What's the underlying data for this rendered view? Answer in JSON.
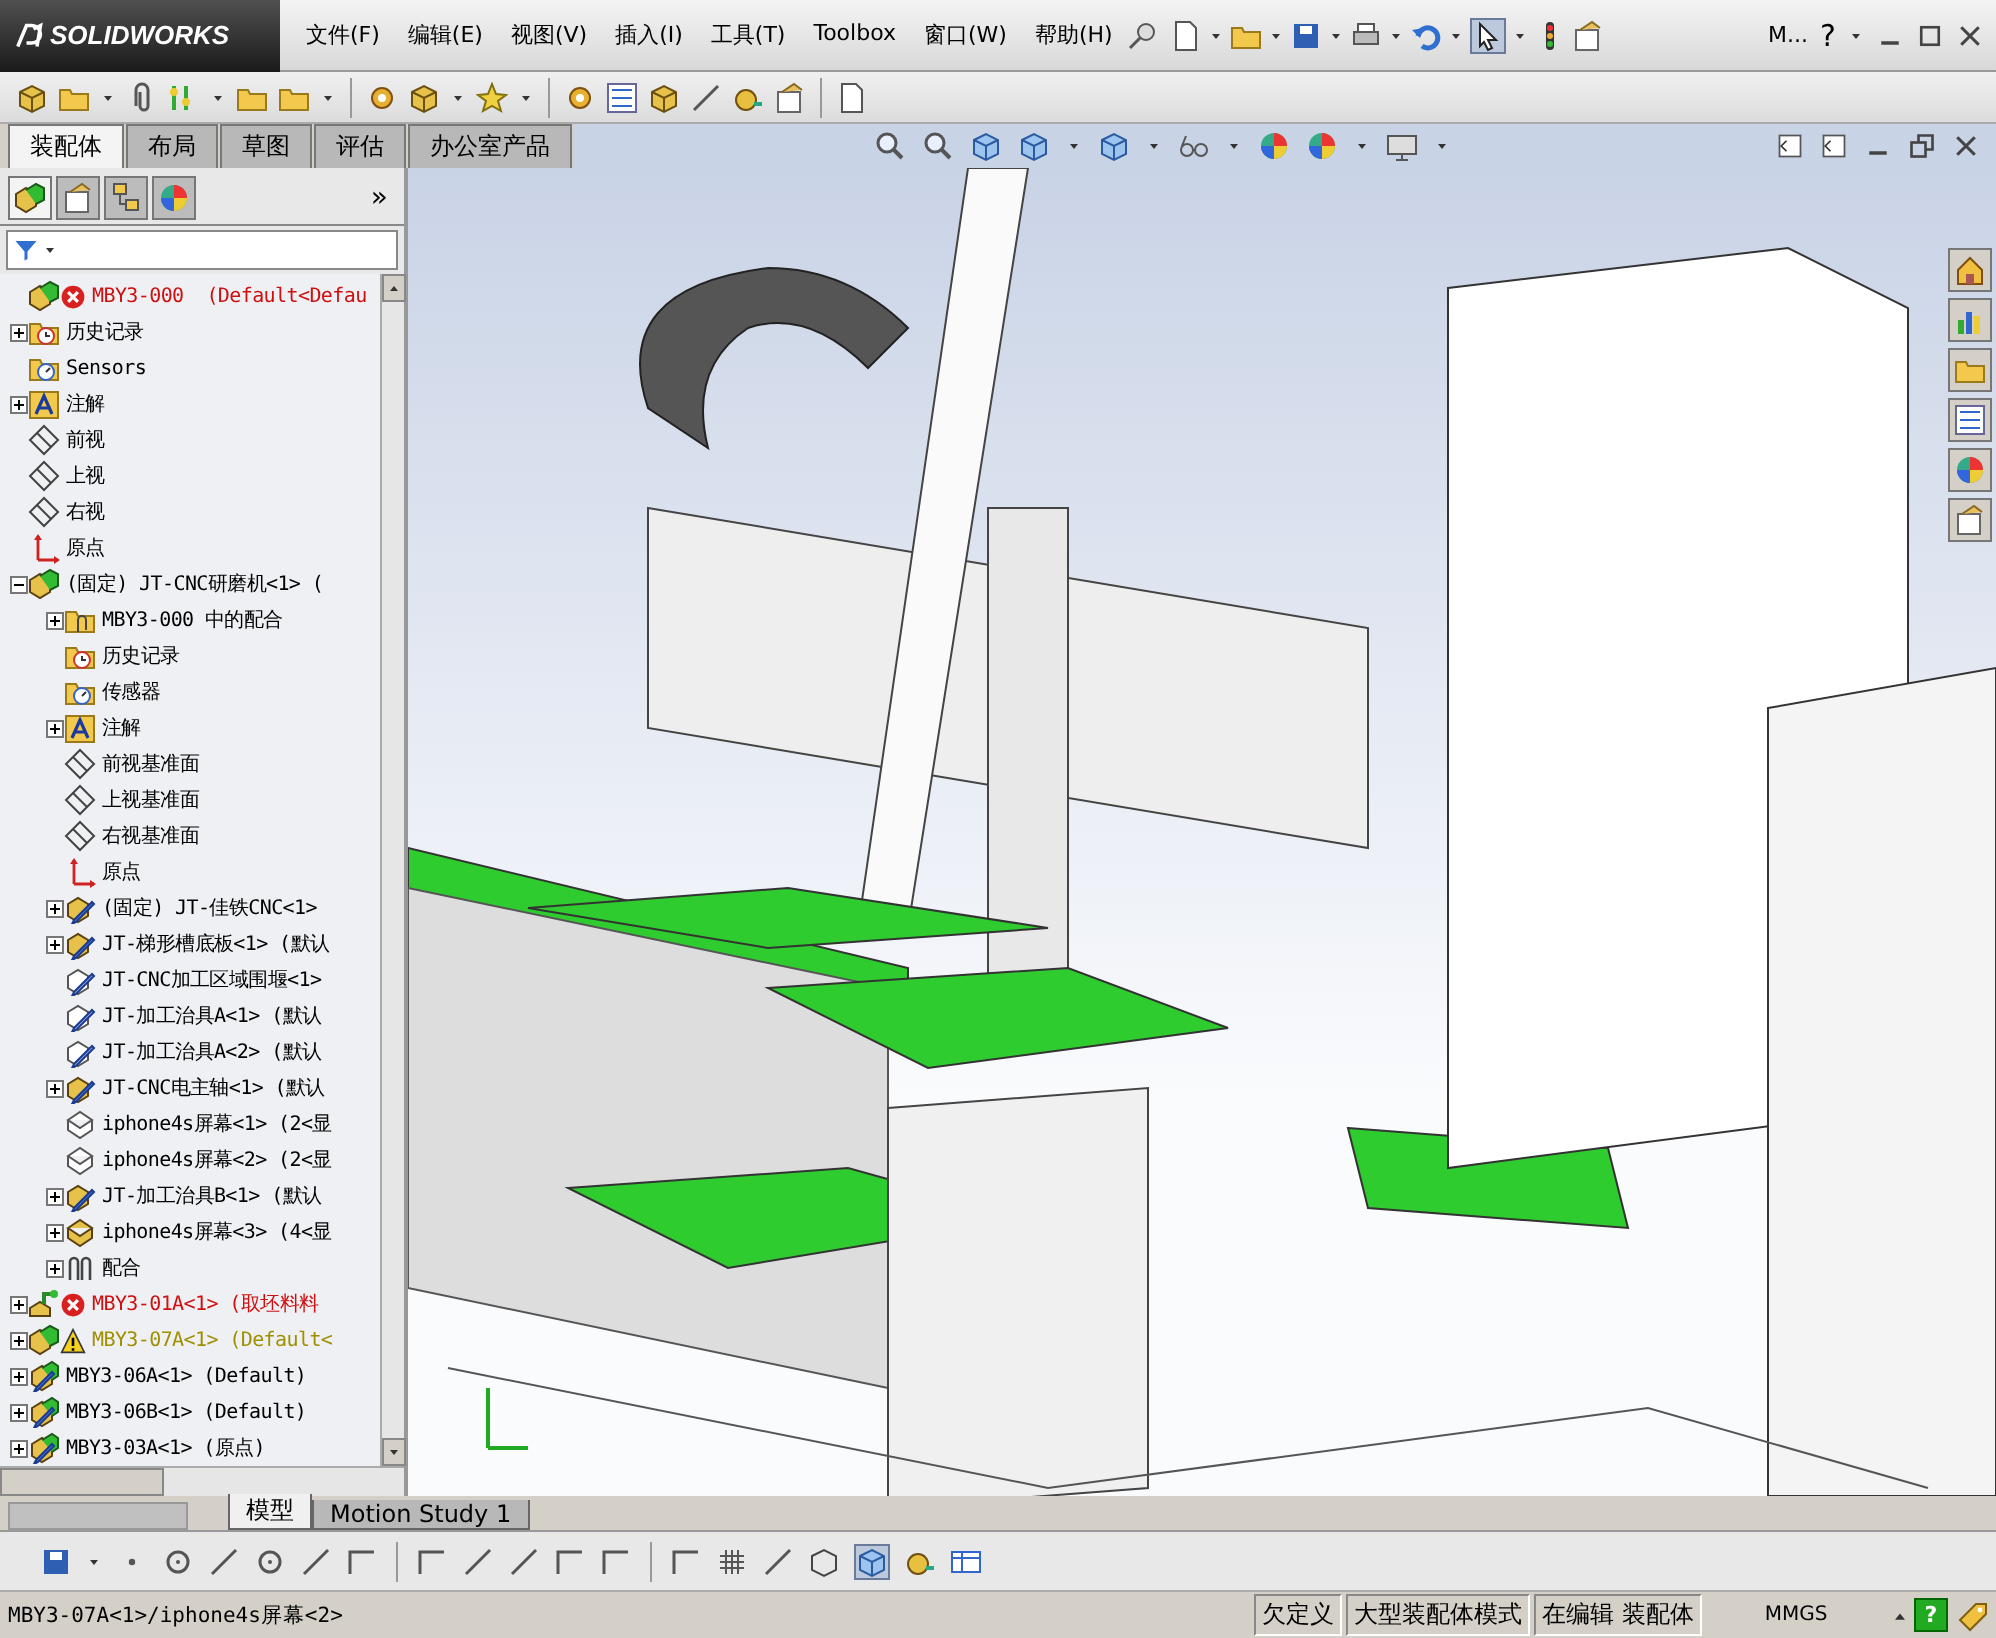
{
  "window": {
    "logo": "SOLIDWORKS",
    "menu": [
      "文件(F)",
      "编辑(E)",
      "视图(V)",
      "插入(I)",
      "工具(T)",
      "Toolbox",
      "窗口(W)",
      "帮助(H)"
    ],
    "truncated_label": "M...",
    "help": "?"
  },
  "command_tabs": [
    {
      "label": "装配体",
      "selected": true
    },
    {
      "label": "布局",
      "selected": false
    },
    {
      "label": "草图",
      "selected": false
    },
    {
      "label": "评估",
      "selected": false
    },
    {
      "label": "办公室产品",
      "selected": false
    }
  ],
  "panel": {
    "tabs": [
      {
        "kind": "tree",
        "selected": true
      },
      {
        "kind": "property",
        "selected": false
      },
      {
        "kind": "config",
        "selected": false
      },
      {
        "kind": "display",
        "selected": false
      }
    ],
    "more": "»",
    "tree": [
      {
        "label": "MBY3-000  (Default<Defau",
        "kind": "assembly",
        "error": true,
        "warning": false,
        "children": [
          {
            "label": "历史记录",
            "kind": "history",
            "error": false,
            "warning": false,
            "expanded": false
          },
          {
            "label": "Sensors",
            "kind": "sensor",
            "error": false,
            "warning": false
          },
          {
            "label": "注解",
            "kind": "annotation",
            "error": false,
            "warning": false,
            "expanded": false
          },
          {
            "label": "前视",
            "kind": "plane",
            "error": false,
            "warning": false
          },
          {
            "label": "上视",
            "kind": "plane",
            "error": false,
            "warning": false
          },
          {
            "label": "右视",
            "kind": "plane",
            "error": false,
            "warning": false
          },
          {
            "label": "原点",
            "kind": "origin",
            "error": false,
            "warning": false
          },
          {
            "label": "(固定) JT-CNC研磨机<1> (",
            "kind": "assembly",
            "error": false,
            "warning": false,
            "expanded": true,
            "children": [
              {
                "label": "MBY3-000 中的配合",
                "kind": "mates-folder",
                "error": false,
                "warning": false,
                "expanded": false
              },
              {
                "label": "历史记录",
                "kind": "history",
                "error": false,
                "warning": false
              },
              {
                "label": "传感器",
                "kind": "sensor",
                "error": false,
                "warning": false
              },
              {
                "label": "注解",
                "kind": "annotation",
                "error": false,
                "warning": false,
                "expanded": false
              },
              {
                "label": "前视基准面",
                "kind": "plane",
                "error": false,
                "warning": false
              },
              {
                "label": "上视基准面",
                "kind": "plane",
                "error": false,
                "warning": false
              },
              {
                "label": "右视基准面",
                "kind": "plane",
                "error": false,
                "warning": false
              },
              {
                "label": "原点",
                "kind": "origin",
                "error": false,
                "warning": false
              },
              {
                "label": "(固定) JT-佳铁CNC<1>",
                "kind": "subassembly",
                "error": false,
                "warning": false,
                "expanded": false
              },
              {
                "label": "JT-梯形槽底板<1> (默认",
                "kind": "subassembly",
                "error": false,
                "warning": false,
                "expanded": false
              },
              {
                "label": "JT-CNC加工区域围堰<1>",
                "kind": "subassembly-outline",
                "error": false,
                "warning": false
              },
              {
                "label": "JT-加工治具A<1> (默认",
                "kind": "subassembly-outline",
                "error": false,
                "warning": false
              },
              {
                "label": "JT-加工治具A<2> (默认",
                "kind": "subassembly-outline",
                "error": false,
                "warning": false
              },
              {
                "label": "JT-CNC电主轴<1> (默认",
                "kind": "subassembly",
                "error": false,
                "warning": false,
                "expanded": false
              },
              {
                "label": "iphone4s屏幕<1> (2<显",
                "kind": "part",
                "error": false,
                "warning": false
              },
              {
                "label": "iphone4s屏幕<2> (2<显",
                "kind": "part",
                "error": false,
                "warning": false
              },
              {
                "label": "JT-加工治具B<1> (默认",
                "kind": "subassembly",
                "error": false,
                "warning": false,
                "expanded": false
              },
              {
                "label": "iphone4s屏幕<3> (4<显",
                "kind": "part-solid",
                "error": false,
                "warning": false,
                "expanded": false
              },
              {
                "label": "配合",
                "kind": "mates",
                "error": false,
                "warning": false,
                "expanded": false
              }
            ]
          },
          {
            "label": "MBY3-01A<1> (取坯料料",
            "kind": "flexible",
            "error": true,
            "warning": false,
            "expanded": false
          },
          {
            "label": "MBY3-07A<1> (Default<",
            "kind": "assembly",
            "error": false,
            "warning": true,
            "expanded": false
          },
          {
            "label": "MBY3-06A<1> (Default)",
            "kind": "subassembly-green",
            "error": false,
            "warning": false,
            "expanded": false
          },
          {
            "label": "MBY3-06B<1> (Default)",
            "kind": "subassembly-green",
            "error": false,
            "warning": false,
            "expanded": false
          },
          {
            "label": "MBY3-03A<1> (原点)",
            "kind": "subassembly-green",
            "error": false,
            "warning": false,
            "expanded": false
          }
        ]
      }
    ]
  },
  "bottom_tabs": [
    {
      "label": "模型",
      "selected": true
    },
    {
      "label": "Motion Study 1",
      "selected": false
    }
  ],
  "status_bar": {
    "path": "MBY3-07A<1>/iphone4s屏幕<2>",
    "segments": [
      "欠定义",
      "大型装配体模式",
      "在编辑 装配体"
    ],
    "units": "MMGS",
    "help": "?"
  }
}
